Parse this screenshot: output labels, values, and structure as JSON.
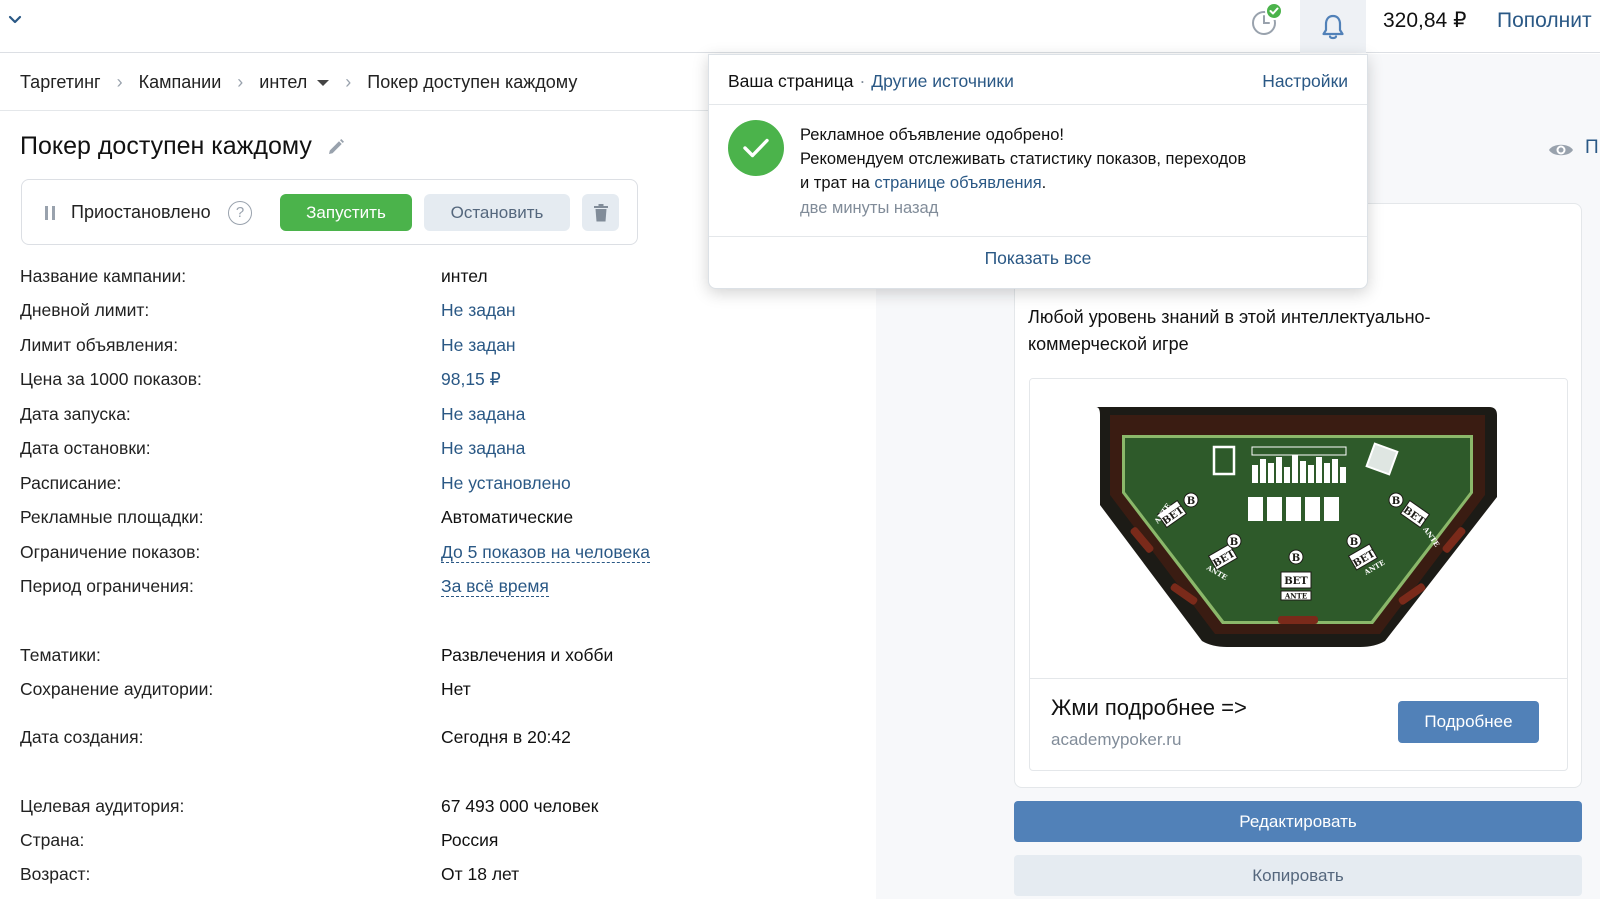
{
  "topbar": {
    "balance": "320,84 ₽",
    "topup_label": "Пополнит",
    "icons": [
      "chevron-down-icon",
      "history-icon",
      "check-badge-icon",
      "bell-icon"
    ],
    "colors": {
      "accent": "#2a5885",
      "success": "#4bb34b",
      "primary_button": "#5181b8"
    }
  },
  "breadcrumb": {
    "items": [
      "Таргетинг",
      "Кампании",
      "интел",
      "Покер доступен каждому"
    ]
  },
  "page": {
    "title": "Покер доступен каждому",
    "status_text": "Приостановлено",
    "help_symbol": "?",
    "start_label": "Запустить",
    "stop_label": "Остановить"
  },
  "fields": [
    {
      "label": "Название кампании:",
      "value": "интел"
    },
    {
      "label": "Дневной лимит:",
      "value": "Не задан"
    },
    {
      "label": "Лимит объявления:",
      "value": "Не задан"
    },
    {
      "label": "Цена за 1000 показов:",
      "value": "98,15 ₽"
    },
    {
      "label": "Дата запуска:",
      "value": "Не задана"
    },
    {
      "label": "Дата остановки:",
      "value": "Не задана"
    },
    {
      "label": "Расписание:",
      "value": "Не установлено"
    },
    {
      "label": "Рекламные площадки:",
      "value": "Автоматические"
    },
    {
      "label": "Ограничение показов:",
      "value": "До 5 показов на человека"
    },
    {
      "label": "Период ограничения:",
      "value": "За всё время"
    },
    {
      "label": "Тематики:",
      "value": "Развлечения и хобби"
    },
    {
      "label": "Сохранение аудитории:",
      "value": "Нет"
    },
    {
      "label": "Дата создания:",
      "value": "Сегодня в 20:42"
    },
    {
      "label": "Целевая аудитория:",
      "value": "67 493 000 человек"
    },
    {
      "label": "Страна:",
      "value": "Россия"
    },
    {
      "label": "Возраст:",
      "value": "От 18 лет"
    }
  ],
  "preview": {
    "side_label": "П",
    "ad_text": "Любой уровень знаний в этой интеллектуально-коммерческой игре",
    "headline": "Жми подробнее =>",
    "domain": "academypoker.ru",
    "more_label": "Подробнее",
    "edit_label": "Редактировать",
    "copy_label": "Копировать",
    "table_labels": {
      "bet": "BET",
      "ante": "ANTE",
      "b": "B"
    }
  },
  "notification": {
    "tab_active": "Ваша страница",
    "tab_dot": "·",
    "tab_other": "Другие источники",
    "settings_label": "Настройки",
    "line1": "Рекламное объявление одобрено!",
    "line2": "Рекомендуем отслеживать статистику показов, переходов",
    "line3_prefix": "и трат на ",
    "line3_link": "странице объявления",
    "line3_suffix": ".",
    "time": "две минуты назад",
    "show_all": "Показать все"
  }
}
